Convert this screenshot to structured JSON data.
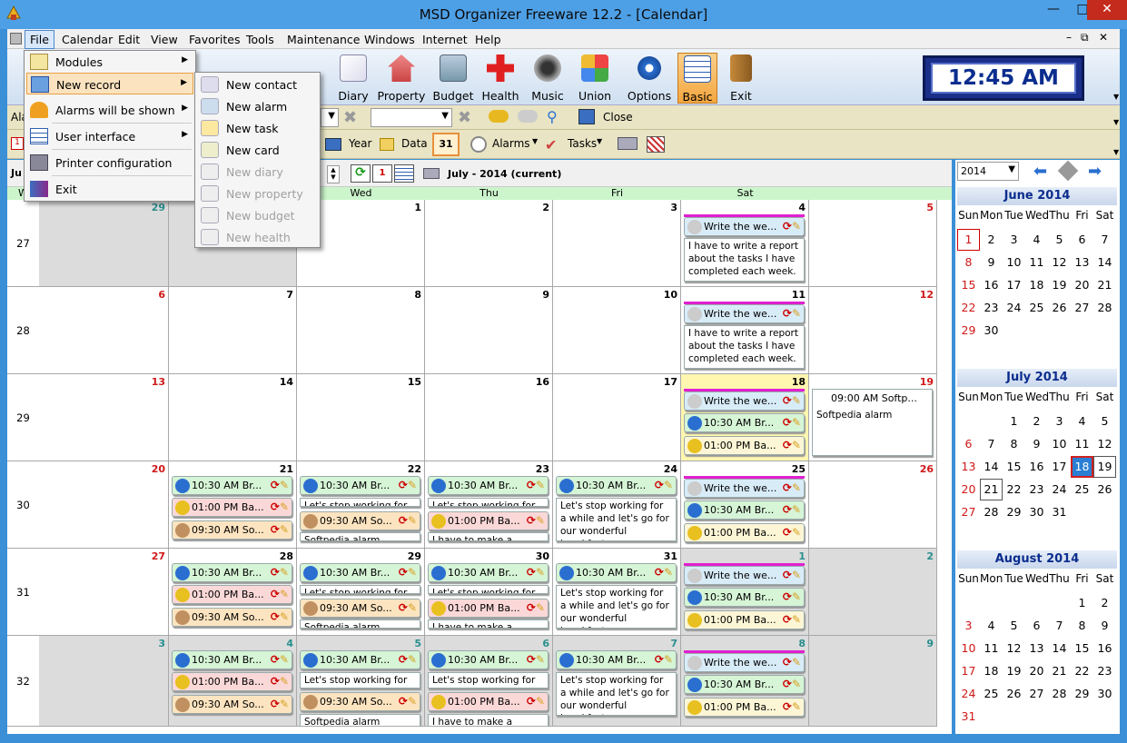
{
  "window": {
    "title": "MSD Organizer Freeware 12.2 - [Calendar]"
  },
  "menu": [
    "File",
    "Calendar",
    "Edit",
    "View",
    "Favorites",
    "Tools",
    "Maintenance",
    "Windows",
    "Internet",
    "Help"
  ],
  "toolbar": {
    "buttons": [
      "Diary",
      "Property",
      "Budget",
      "Health",
      "Music",
      "Union",
      "Options",
      "Basic",
      "Exit"
    ],
    "partial": "ds"
  },
  "clock": "12:45 AM",
  "bar2": {
    "label": "Ala",
    "close": "Close"
  },
  "bar3": {
    "year": "Year",
    "data": "Data",
    "alarms": "Alarms",
    "tasks": "Tasks",
    "today_icon": "31"
  },
  "nav": {
    "month_label": "July - 2014 (current)",
    "left_label": "Ju"
  },
  "day_headers": [
    "W",
    "Mon",
    "Tue",
    "Wed",
    "Thu",
    "Fri",
    "Sat"
  ],
  "weeks": [
    {
      "no": "27",
      "days": [
        {
          "d": "29",
          "c": "teal",
          "out": true
        },
        {
          "d": "30",
          "c": "teal",
          "out": true
        },
        {
          "d": "1"
        },
        {
          "d": "2"
        },
        {
          "d": "3"
        },
        {
          "d": "4",
          "fri": true
        },
        {
          "d": "5",
          "c": "red"
        }
      ]
    },
    {
      "no": "28",
      "days": [
        {
          "d": "6",
          "c": "red"
        },
        {
          "d": "7"
        },
        {
          "d": "8"
        },
        {
          "d": "9"
        },
        {
          "d": "10"
        },
        {
          "d": "11",
          "fri": true
        },
        {
          "d": "12",
          "c": "red"
        }
      ]
    },
    {
      "no": "29",
      "days": [
        {
          "d": "13",
          "c": "red"
        },
        {
          "d": "14"
        },
        {
          "d": "15"
        },
        {
          "d": "16"
        },
        {
          "d": "17"
        },
        {
          "d": "18",
          "fri": true,
          "today": true
        },
        {
          "d": "19",
          "c": "red"
        }
      ]
    },
    {
      "no": "30",
      "days": [
        {
          "d": "20",
          "c": "red"
        },
        {
          "d": "21"
        },
        {
          "d": "22"
        },
        {
          "d": "23"
        },
        {
          "d": "24"
        },
        {
          "d": "25",
          "fri": true
        },
        {
          "d": "26",
          "c": "red"
        }
      ]
    },
    {
      "no": "31",
      "days": [
        {
          "d": "27",
          "c": "red"
        },
        {
          "d": "28"
        },
        {
          "d": "29"
        },
        {
          "d": "30"
        },
        {
          "d": "31"
        },
        {
          "d": "1",
          "c": "teal",
          "out": true
        },
        {
          "d": "2",
          "c": "teal",
          "out": true
        }
      ]
    },
    {
      "no": "32",
      "days": [
        {
          "d": "3",
          "c": "teal",
          "out": true
        },
        {
          "d": "4",
          "c": "teal",
          "out": true
        },
        {
          "d": "5",
          "c": "teal",
          "out": true
        },
        {
          "d": "6",
          "c": "teal",
          "out": true
        },
        {
          "d": "7",
          "c": "teal",
          "out": true
        },
        {
          "d": "8",
          "c": "teal",
          "out": true
        },
        {
          "d": "9",
          "c": "teal",
          "out": true
        }
      ]
    }
  ],
  "events": {
    "write_title": "Write the we...",
    "write_note": "I have to write a report about the tasks I have completed each week.",
    "breakfast": "10:30 AM Br...",
    "bank": "01:00 PM Ba...",
    "so": "09:30 AM So...",
    "stop_note": "Let's stop working for a while and let's go for our wonderful breakfast.",
    "stop_short": "Let's stop working for a",
    "softpedia_alarm": "Softpedia alarm",
    "softpedia_title": "09:00 AM Softp...",
    "backup": "I have to make a backup"
  },
  "filemenu": {
    "items": [
      "Modules",
      "New record",
      "Alarms will be shown",
      "User interface",
      "Printer configuration",
      "Exit"
    ]
  },
  "submenu": {
    "items": [
      {
        "t": "New contact",
        "dis": false
      },
      {
        "t": "New alarm",
        "dis": false
      },
      {
        "t": "New task",
        "dis": false
      },
      {
        "t": "New card",
        "dis": false
      },
      {
        "t": "New diary",
        "dis": true
      },
      {
        "t": "New property",
        "dis": true
      },
      {
        "t": "New budget",
        "dis": true
      },
      {
        "t": "New health",
        "dis": true
      }
    ]
  },
  "right": {
    "year": "2014",
    "dow": [
      "Sun",
      "Mon",
      "Tue",
      "Wed",
      "Thu",
      "Fri",
      "Sat"
    ],
    "months": [
      {
        "title": "June 2014",
        "start": 0,
        "days": 30,
        "marked": 1
      },
      {
        "title": "July 2014",
        "start": 2,
        "days": 31,
        "today": 18,
        "boxed": 19,
        "marked2": 21
      },
      {
        "title": "August 2014",
        "start": 5,
        "days": 31
      }
    ]
  }
}
